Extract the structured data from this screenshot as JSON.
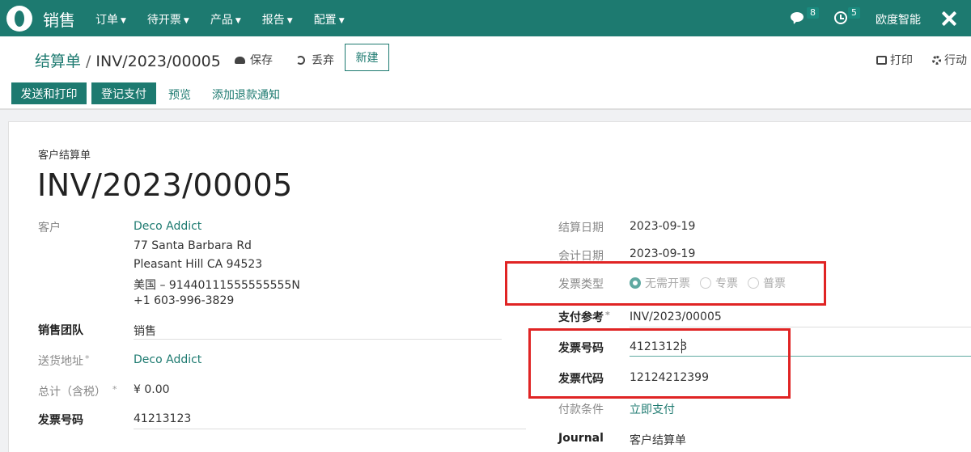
{
  "navbar": {
    "app_name": "销售",
    "menu": [
      {
        "label": "订单"
      },
      {
        "label": "待开票"
      },
      {
        "label": "产品"
      },
      {
        "label": "报告"
      },
      {
        "label": "配置"
      }
    ],
    "chat_count": "8",
    "activity_count": "5",
    "company": "欧度智能"
  },
  "control": {
    "breadcrumb_parent": "结算单",
    "breadcrumb_sep": "/",
    "breadcrumb_current": "INV/2023/00005",
    "save_label": "保存",
    "discard_label": "丢弃",
    "new_label": "新建",
    "print_label": "打印",
    "action_label": "行动"
  },
  "statusbar": {
    "send_print": "发送和打印",
    "register_payment": "登记支付",
    "preview": "预览",
    "add_refund": "添加退款通知"
  },
  "form": {
    "doc_type": "客户结算单",
    "number": "INV/2023/00005",
    "customer_label": "客户",
    "customer_name": "Deco Addict",
    "address_line1": "77 Santa Barbara Rd",
    "address_line2": "Pleasant Hill CA 94523",
    "address_line3": "美国 – 91440111555555555N",
    "address_line4": "+1 603-996-3829",
    "team_label": "销售团队",
    "team_value": "销售",
    "delivery_label": "送货地址",
    "delivery_value": "Deco Addict",
    "total_label": "总计（含税）",
    "total_value": "¥ 0.00",
    "invoice_no_label_left": "发票号码",
    "invoice_no_value_left": "41213123",
    "invoice_date_label": "结算日期",
    "invoice_date": "2023-09-19",
    "accounting_date_label": "会计日期",
    "accounting_date": "2023-09-19",
    "invoice_type_label": "发票类型",
    "invoice_type_options": [
      "无需开票",
      "专票",
      "普票"
    ],
    "payment_ref_label": "支付参考",
    "payment_ref": "INV/2023/00005",
    "invoice_no_label": "发票号码",
    "invoice_no": "41213123",
    "invoice_code_label": "发票代码",
    "invoice_code": "12124212399",
    "payment_terms_label": "付款条件",
    "payment_terms": "立即支付",
    "journal_label": "Journal",
    "journal": "客户结算单"
  },
  "colors": {
    "brand": "#1d7a70",
    "highlight_box": "#e02424"
  }
}
